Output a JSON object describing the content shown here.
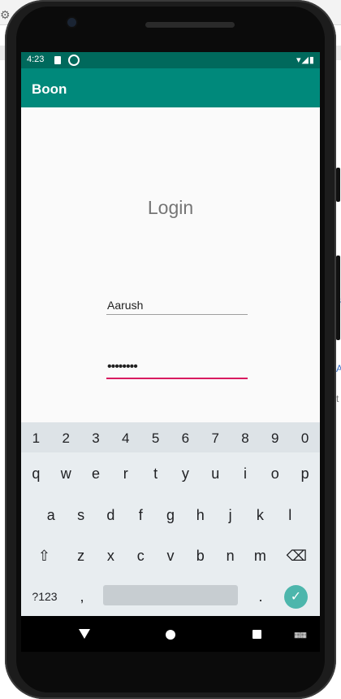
{
  "status": {
    "time": "4:23"
  },
  "app": {
    "title": "Boon"
  },
  "login": {
    "title": "Login",
    "username_value": "Aarush",
    "password_value": "••••••••"
  },
  "keyboard": {
    "numbers": [
      "1",
      "2",
      "3",
      "4",
      "5",
      "6",
      "7",
      "8",
      "9",
      "0"
    ],
    "row1": [
      "q",
      "w",
      "e",
      "r",
      "t",
      "y",
      "u",
      "i",
      "o",
      "p"
    ],
    "row2": [
      "a",
      "s",
      "d",
      "f",
      "g",
      "h",
      "j",
      "k",
      "l"
    ],
    "row3": [
      "z",
      "x",
      "c",
      "v",
      "b",
      "n",
      "m"
    ],
    "symbols_label": "?123",
    "comma": ",",
    "period": "."
  },
  "colors": {
    "app_bar": "#00897b",
    "status_bar": "#00695c",
    "password_underline": "#d81b60",
    "enter_key": "#4db6ac"
  }
}
